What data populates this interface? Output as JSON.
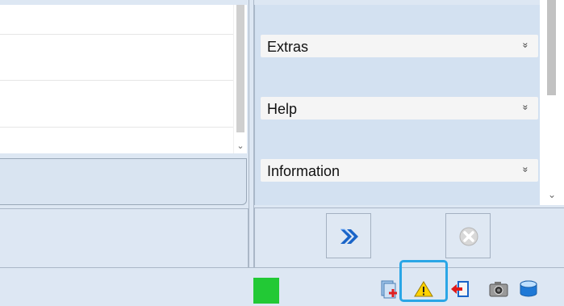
{
  "task_pane": {
    "sections": [
      {
        "label": "Extras",
        "chevron": "»"
      },
      {
        "label": "Help",
        "chevron": "»"
      },
      {
        "label": "Information",
        "chevron": "»"
      }
    ]
  },
  "scrollbars": {
    "left_arrow": "⌄",
    "right_arrow": "⌄"
  },
  "actions": {
    "forward_icon": "double-chevron-right-icon",
    "cancel_icon": "cancel-circle-icon"
  },
  "statusbar": {
    "indicator_color": "#22c935",
    "tray_icons": [
      "add-document-icon",
      "warning-icon",
      "exit-icon",
      "camera-icon",
      "database-icon"
    ]
  },
  "colors": {
    "highlight": "#2aa6e6",
    "forward_arrow": "#1a64c8",
    "warning_fill": "#ffd200"
  }
}
